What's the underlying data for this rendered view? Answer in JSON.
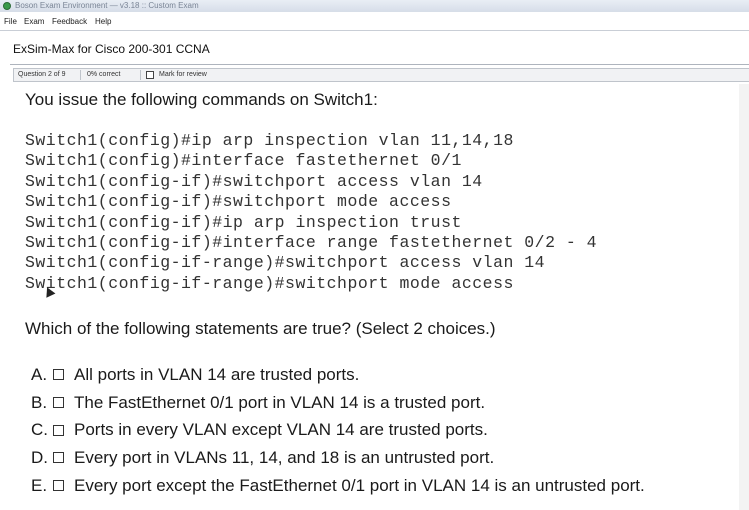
{
  "window": {
    "title": "Boson Exam Environment — v3.18 :: Custom Exam"
  },
  "menu": {
    "items": [
      "File",
      "Exam",
      "Feedback",
      "Help"
    ]
  },
  "exam": {
    "title": "ExSim-Max for Cisco 200-301 CCNA"
  },
  "status": {
    "question_position": "Question 2 of 9",
    "percent_correct": "0% correct",
    "mark_for_review": "Mark for review"
  },
  "question": {
    "intro": "You issue the following commands on Switch1:",
    "commands": [
      "Switch1(config)#ip arp inspection vlan 11,14,18",
      "Switch1(config)#interface fastethernet 0/1",
      "Switch1(config-if)#switchport access vlan 14",
      "Switch1(config-if)#switchport mode access",
      "Switch1(config-if)#ip arp inspection trust",
      "Switch1(config-if)#interface range fastethernet 0/2 - 4",
      "Switch1(config-if-range)#switchport access vlan 14",
      "Switch1(config-if-range)#switchport mode access"
    ],
    "prompt": "Which of the following statements are true?  (Select 2 choices.)",
    "choices": [
      {
        "letter": "A.",
        "text": "All ports in VLAN 14 are trusted ports."
      },
      {
        "letter": "B.",
        "text": "The FastEthernet 0/1 port in VLAN 14 is a trusted port."
      },
      {
        "letter": "C.",
        "text": "Ports in every VLAN except VLAN 14 are trusted ports."
      },
      {
        "letter": "D.",
        "text": "Every port in VLANs 11, 14, and 18 is an untrusted port."
      },
      {
        "letter": "E.",
        "text": "Every port except the FastEthernet 0/1 port in VLAN 14 is an untrusted port."
      }
    ]
  },
  "icons": {
    "app": "boson-logo-icon",
    "checkbox": "checkbox-icon",
    "cursor": "mouse-pointer-icon"
  },
  "colors": {
    "accent_logo": "#3a9a4a",
    "text": "#1a1a1a",
    "code_text": "#333333"
  }
}
